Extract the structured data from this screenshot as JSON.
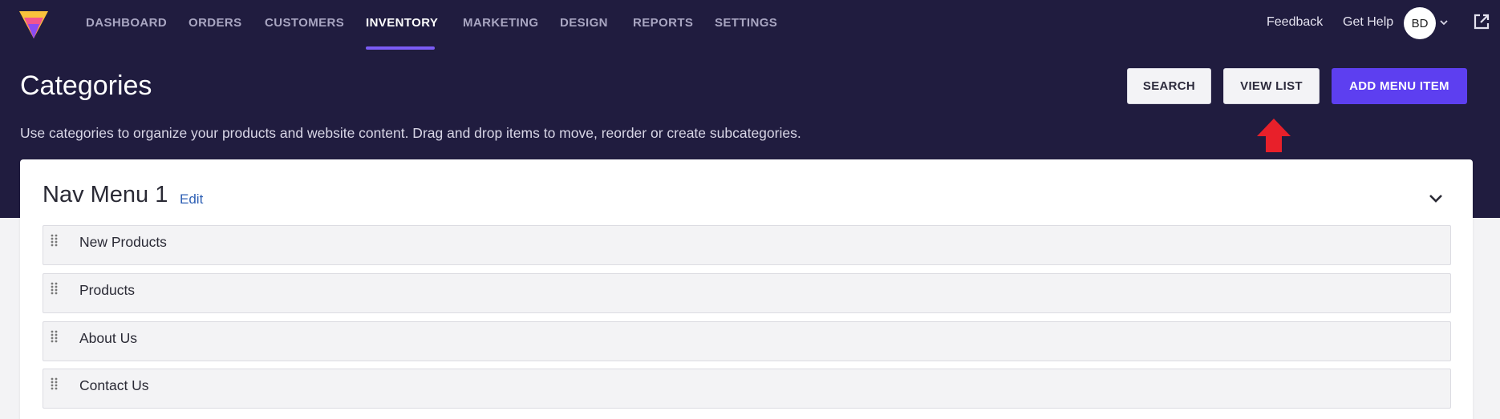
{
  "nav": {
    "items": [
      {
        "label": "DASHBOARD"
      },
      {
        "label": "ORDERS"
      },
      {
        "label": "CUSTOMERS"
      },
      {
        "label": "INVENTORY",
        "active": true
      },
      {
        "label": "MARKETING"
      },
      {
        "label": "DESIGN"
      },
      {
        "label": "REPORTS"
      },
      {
        "label": "SETTINGS"
      }
    ],
    "feedback": "Feedback",
    "help": "Get Help",
    "avatar_initials": "BD"
  },
  "header": {
    "title": "Categories",
    "description": "Use categories to organize your products and website content. Drag and drop items to move, reorder or create subcategories.",
    "buttons": {
      "search": "SEARCH",
      "view_list": "VIEW LIST",
      "add_menu_item": "ADD MENU ITEM"
    }
  },
  "menu": {
    "title": "Nav Menu 1",
    "edit": "Edit",
    "items": [
      {
        "label": "New Products"
      },
      {
        "label": "Products"
      },
      {
        "label": "About Us"
      },
      {
        "label": "Contact Us"
      }
    ]
  },
  "colors": {
    "header_bg": "#201c3f",
    "accent": "#5d3ff0",
    "annotation_arrow": "#e8202a"
  },
  "icons": [
    "logo-icon",
    "chevron-down-icon",
    "external-link-icon",
    "drag-handle-icon",
    "arrow-up-icon"
  ]
}
